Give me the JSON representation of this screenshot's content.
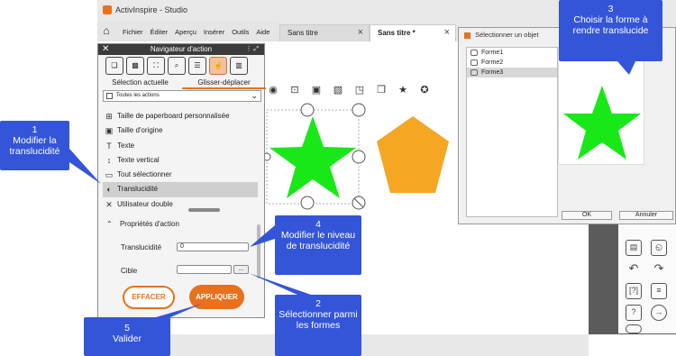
{
  "app": {
    "title": "ActivInspire - Studio"
  },
  "menu": [
    "Fichier",
    "Éditer",
    "Aperçu",
    "Insérer",
    "Outils",
    "Aide"
  ],
  "tabs": [
    {
      "label": "Sans titre",
      "close": "×"
    },
    {
      "label": "Sans titre *",
      "close": "×"
    }
  ],
  "nav": {
    "title": "Navigateur d'action",
    "subtabs": [
      "Sélection actuelle",
      "Glisser-déplacer"
    ],
    "dropdown": "Toutes les actions",
    "items": [
      "Taille de paperboard personnalisée",
      "Taille d'origine",
      "Texte",
      "Texte vertical",
      "Tout sélectionner",
      "Translucidité",
      "Utilisateur double"
    ],
    "props_header": "Propriétés d'action",
    "transl_label": "Translucidité",
    "transl_value": "0",
    "target_label": "Cible",
    "dots": "...",
    "clear": "EFFACER",
    "apply": "APPLIQUER"
  },
  "dialog": {
    "title": "Sélectionner un objet",
    "items": [
      "Forme1",
      "Forme2",
      "Forme3"
    ],
    "selected_index": 2,
    "ok": "OK",
    "cancel": "Annuler"
  },
  "callouts": {
    "c1": {
      "num": "1",
      "text": "Modifier la translucidité"
    },
    "c2": {
      "num": "2",
      "text": "Sélectionner parmi les formes"
    },
    "c3": {
      "num": "3",
      "text": "Choisir la forme à rendre translucide"
    },
    "c4": {
      "num": "4",
      "text": "Modifier le niveau de translucidité"
    },
    "c5": {
      "num": "5",
      "text": "Valider"
    }
  },
  "colors": {
    "accent": "#e8711f",
    "callout": "#3455d8",
    "star": "#18e818",
    "pentagon": "#f5a623"
  }
}
